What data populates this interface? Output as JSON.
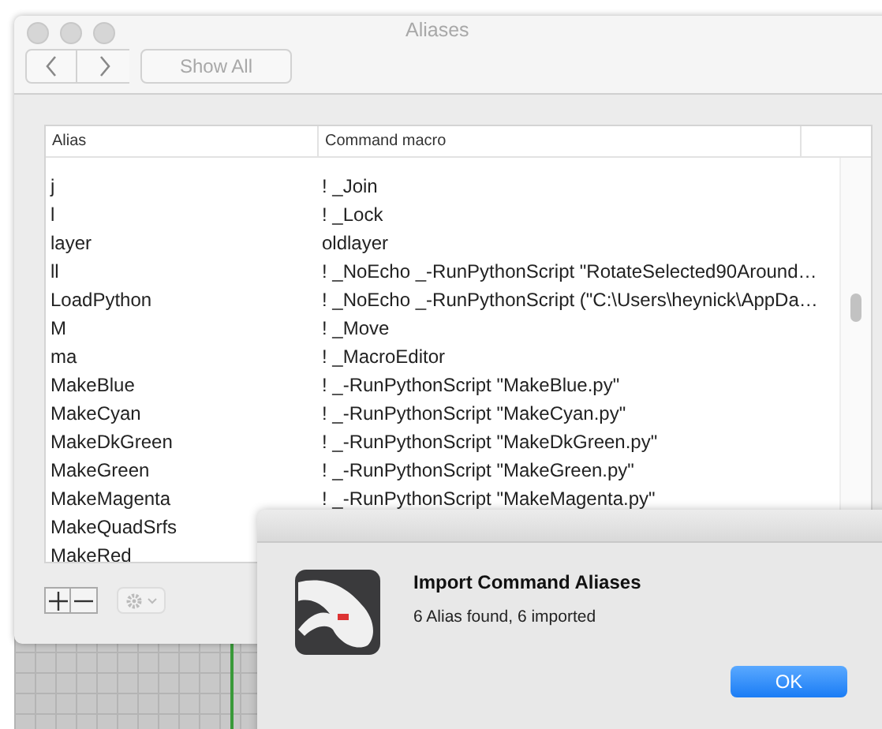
{
  "window": {
    "title": "Aliases",
    "show_all_label": "Show All"
  },
  "table": {
    "columns": [
      "Alias",
      "Command macro"
    ],
    "rows": [
      {
        "alias": "j",
        "command": "! _Join"
      },
      {
        "alias": "l",
        "command": "! _Lock"
      },
      {
        "alias": "layer",
        "command": "oldlayer"
      },
      {
        "alias": "ll",
        "command": "! _NoEcho _-RunPythonScript \"RotateSelected90Around…"
      },
      {
        "alias": "LoadPython",
        "command": "! _NoEcho _-RunPythonScript (\"C:\\Users\\heynick\\AppDa…"
      },
      {
        "alias": "M",
        "command": "! _Move"
      },
      {
        "alias": "ma",
        "command": "! _MacroEditor"
      },
      {
        "alias": "MakeBlue",
        "command": "! _-RunPythonScript \"MakeBlue.py\""
      },
      {
        "alias": "MakeCyan",
        "command": "! _-RunPythonScript \"MakeCyan.py\""
      },
      {
        "alias": "MakeDkGreen",
        "command": "! _-RunPythonScript \"MakeDkGreen.py\""
      },
      {
        "alias": "MakeGreen",
        "command": "! _-RunPythonScript \"MakeGreen.py\""
      },
      {
        "alias": "MakeMagenta",
        "command": "! _-RunPythonScript \"MakeMagenta.py\""
      },
      {
        "alias": "MakeQuadSrfs"
      },
      {
        "alias": "MakeRed"
      }
    ]
  },
  "dialog": {
    "title": "Import Command Aliases",
    "message": "6 Alias found, 6 imported",
    "button": "OK"
  }
}
